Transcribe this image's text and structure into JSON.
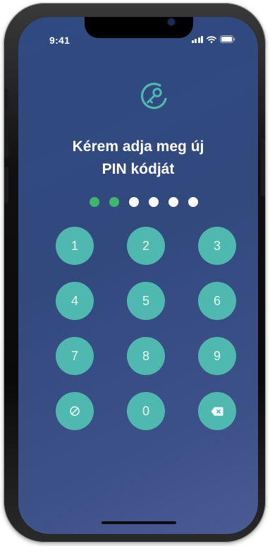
{
  "status_bar": {
    "time": "9:41"
  },
  "header": {
    "title_line1": "Kérem adja meg új",
    "title_line2": "PIN kódját"
  },
  "pin": {
    "length": 6,
    "entered": 2
  },
  "keypad": {
    "keys": [
      {
        "label": "1"
      },
      {
        "label": "2"
      },
      {
        "label": "3"
      },
      {
        "label": "4"
      },
      {
        "label": "5"
      },
      {
        "label": "6"
      },
      {
        "label": "7"
      },
      {
        "label": "8"
      },
      {
        "label": "9"
      },
      {
        "label": "",
        "icon": "cancel-icon"
      },
      {
        "label": "0"
      },
      {
        "label": "",
        "icon": "backspace-icon"
      }
    ]
  },
  "colors": {
    "background": "#32497e",
    "key": "#4fb9b0",
    "dot_filled": "#3fb76b",
    "dot_empty": "#ffffff"
  }
}
